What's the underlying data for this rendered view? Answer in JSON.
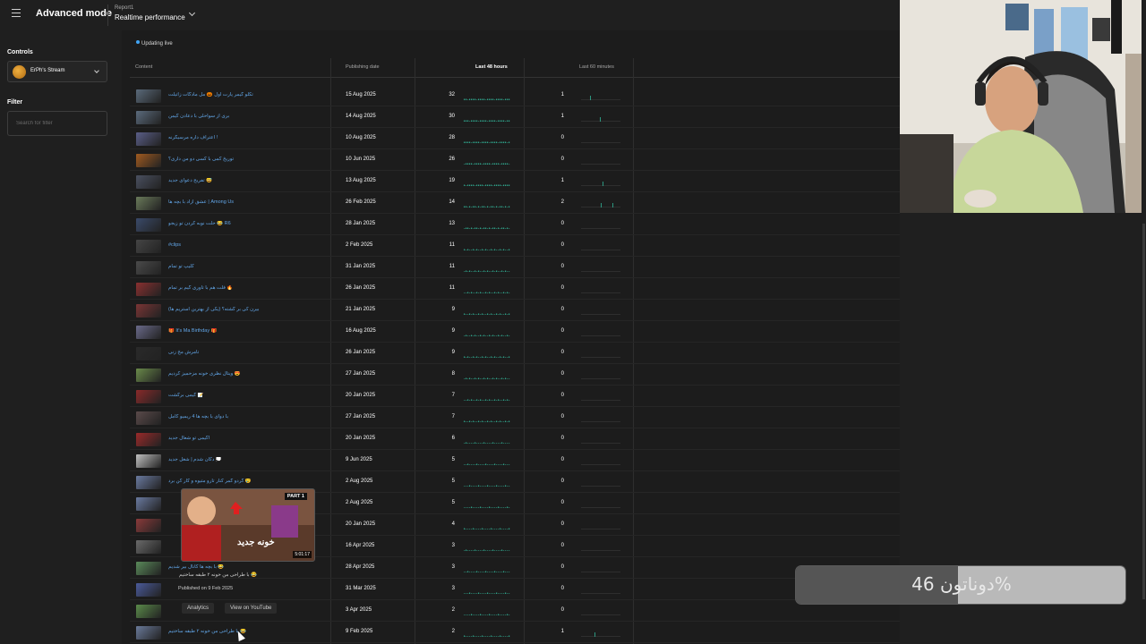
{
  "header": {
    "app_title": "Advanced mode",
    "report_label": "Report1",
    "report_title": "Realtime performance"
  },
  "sidebar": {
    "controls_heading": "Controls",
    "stream_name": "ErPh's Stream",
    "filter_heading": "Filter",
    "filter_placeholder": "Search for filter"
  },
  "status": {
    "live_text": "Updating live"
  },
  "table": {
    "headers": {
      "content": "Content",
      "publishing_date": "Publishing date",
      "last_48h": "Last 48 hours",
      "last_60m": "Last 60 minutes"
    },
    "rows": [
      {
        "title": "تکلو گیمر پارت اول 🎃 مل مادگات زاتیلت",
        "date": "15 Aug 2025",
        "h48": "32",
        "m60": "1",
        "thumb": "#5a6a7a"
      },
      {
        "title": "بری از سواحلی با دعادن گیمن",
        "date": "14 Aug 2025",
        "h48": "30",
        "m60": "1",
        "thumb": "#5b6b7d"
      },
      {
        "title": "اعتراف داره مرسیگرنه !",
        "date": "10 Aug 2025",
        "h48": "28",
        "m60": "0",
        "thumb": "#5a5e88"
      },
      {
        "title": "توریخ کمی با کسی دو من داری؟",
        "date": "10 Jun 2025",
        "h48": "26",
        "m60": "0",
        "thumb": "#a05a20"
      },
      {
        "title": "تفریح دعوای جدید 😅",
        "date": "13 Aug 2025",
        "h48": "19",
        "m60": "1",
        "thumb": "#4a5060"
      },
      {
        "title": "عشق آزاد با بچه ها | Among Us",
        "date": "26 Feb 2025",
        "h48": "14",
        "m60": "2",
        "thumb": "#6a7a5a"
      },
      {
        "title": "حلت نوبه کردن تو زیجو 😂 R6",
        "date": "28 Jan 2025",
        "h48": "13",
        "m60": "0",
        "thumb": "#3a4a6a"
      },
      {
        "title": "#clips",
        "date": "2 Feb 2025",
        "h48": "11",
        "m60": "0",
        "thumb": "#454545"
      },
      {
        "title": "کلیپ تو تمام",
        "date": "31 Jan 2025",
        "h48": "11",
        "m60": "0",
        "thumb": "#4a4a4a"
      },
      {
        "title": "فلت هم با تاوری گیم بر تمام 🔥",
        "date": "26 Jan 2025",
        "h48": "11",
        "m60": "0",
        "thumb": "#8a3030"
      },
      {
        "title": "بیرن کی بر گشته؟ (یکی از بهترین استریم ها)",
        "date": "21 Jan 2025",
        "h48": "9",
        "m60": "0",
        "thumb": "#7a3535"
      },
      {
        "title": "🎁 It's Ma Birthday 🎁",
        "date": "16 Aug 2025",
        "h48": "9",
        "m60": "0",
        "thumb": "#6a6a8a"
      },
      {
        "title": "تامرش مخ زنی",
        "date": "26 Jan 2025",
        "h48": "9",
        "m60": "0",
        "thumb": "#2a2a2a"
      },
      {
        "title": "ویتال نظری خونه مزحمیز کردیم 😍",
        "date": "27 Jan 2025",
        "h48": "8",
        "m60": "0",
        "thumb": "#6a8a4a"
      },
      {
        "title": "گیمی برگشت 📝",
        "date": "20 Jan 2025",
        "h48": "7",
        "m60": "0",
        "thumb": "#8a2a2a"
      },
      {
        "title": "با دوای با بچه ها 4 ریمیو کامل",
        "date": "27 Jan 2025",
        "h48": "7",
        "m60": "0",
        "thumb": "#5a4a4a"
      },
      {
        "title": "اگیمی تو شعال جدید",
        "date": "20 Jan 2025",
        "h48": "6",
        "m60": "0",
        "thumb": "#9a2a2a"
      },
      {
        "title": "دکان شدم | شغل جدید 💭",
        "date": "9 Jun 2025",
        "h48": "5",
        "m60": "0",
        "thumb": "#c0c0c0"
      },
      {
        "title": "گردو گمر کنار تارو متیوه و کار کن برد 😢",
        "date": "2 Aug 2025",
        "h48": "5",
        "m60": "0",
        "thumb": "#6a7aa0"
      },
      {
        "title": "",
        "date": "2 Aug 2025",
        "h48": "5",
        "m60": "0",
        "thumb": "#6a7aa0"
      },
      {
        "title": "",
        "date": "20 Jan 2025",
        "h48": "4",
        "m60": "0",
        "thumb": "#8a3a3a"
      },
      {
        "title": "",
        "date": "16 Apr 2025",
        "h48": "3",
        "m60": "0",
        "thumb": "#6a6a6a"
      },
      {
        "title": "با بچه ها کانال بیر شدیم 😂",
        "date": "28 Apr 2025",
        "h48": "3",
        "m60": "0",
        "thumb": "#5a8a5a"
      },
      {
        "title": "",
        "date": "31 Mar 2025",
        "h48": "3",
        "m60": "0",
        "thumb": "#4a5a9a"
      },
      {
        "title": "",
        "date": "3 Apr 2025",
        "h48": "2",
        "m60": "0",
        "thumb": "#5a8a4a"
      },
      {
        "title": "با طراحی من خونه ۲ طبقه ساختیم 😂",
        "date": "9 Feb 2025",
        "h48": "2",
        "m60": "1",
        "thumb": "#6a7a9a"
      }
    ]
  },
  "hover": {
    "title": "با طراحی من خونه ۲ طبقه ساختیم 😂",
    "published": "Published on 9 Feb 2025",
    "analytics_label": "Analytics",
    "youtube_label": "View on YouTube",
    "preview_badge": "PART 1",
    "preview_title": "خونه جدید",
    "preview_duration": "5:01:17"
  },
  "donation": {
    "text": "دوناتون 46%",
    "progress": 0.46
  },
  "colors": {
    "accent": "#41a5f5",
    "link": "#62a6e8",
    "spark": "#2fa38a"
  }
}
